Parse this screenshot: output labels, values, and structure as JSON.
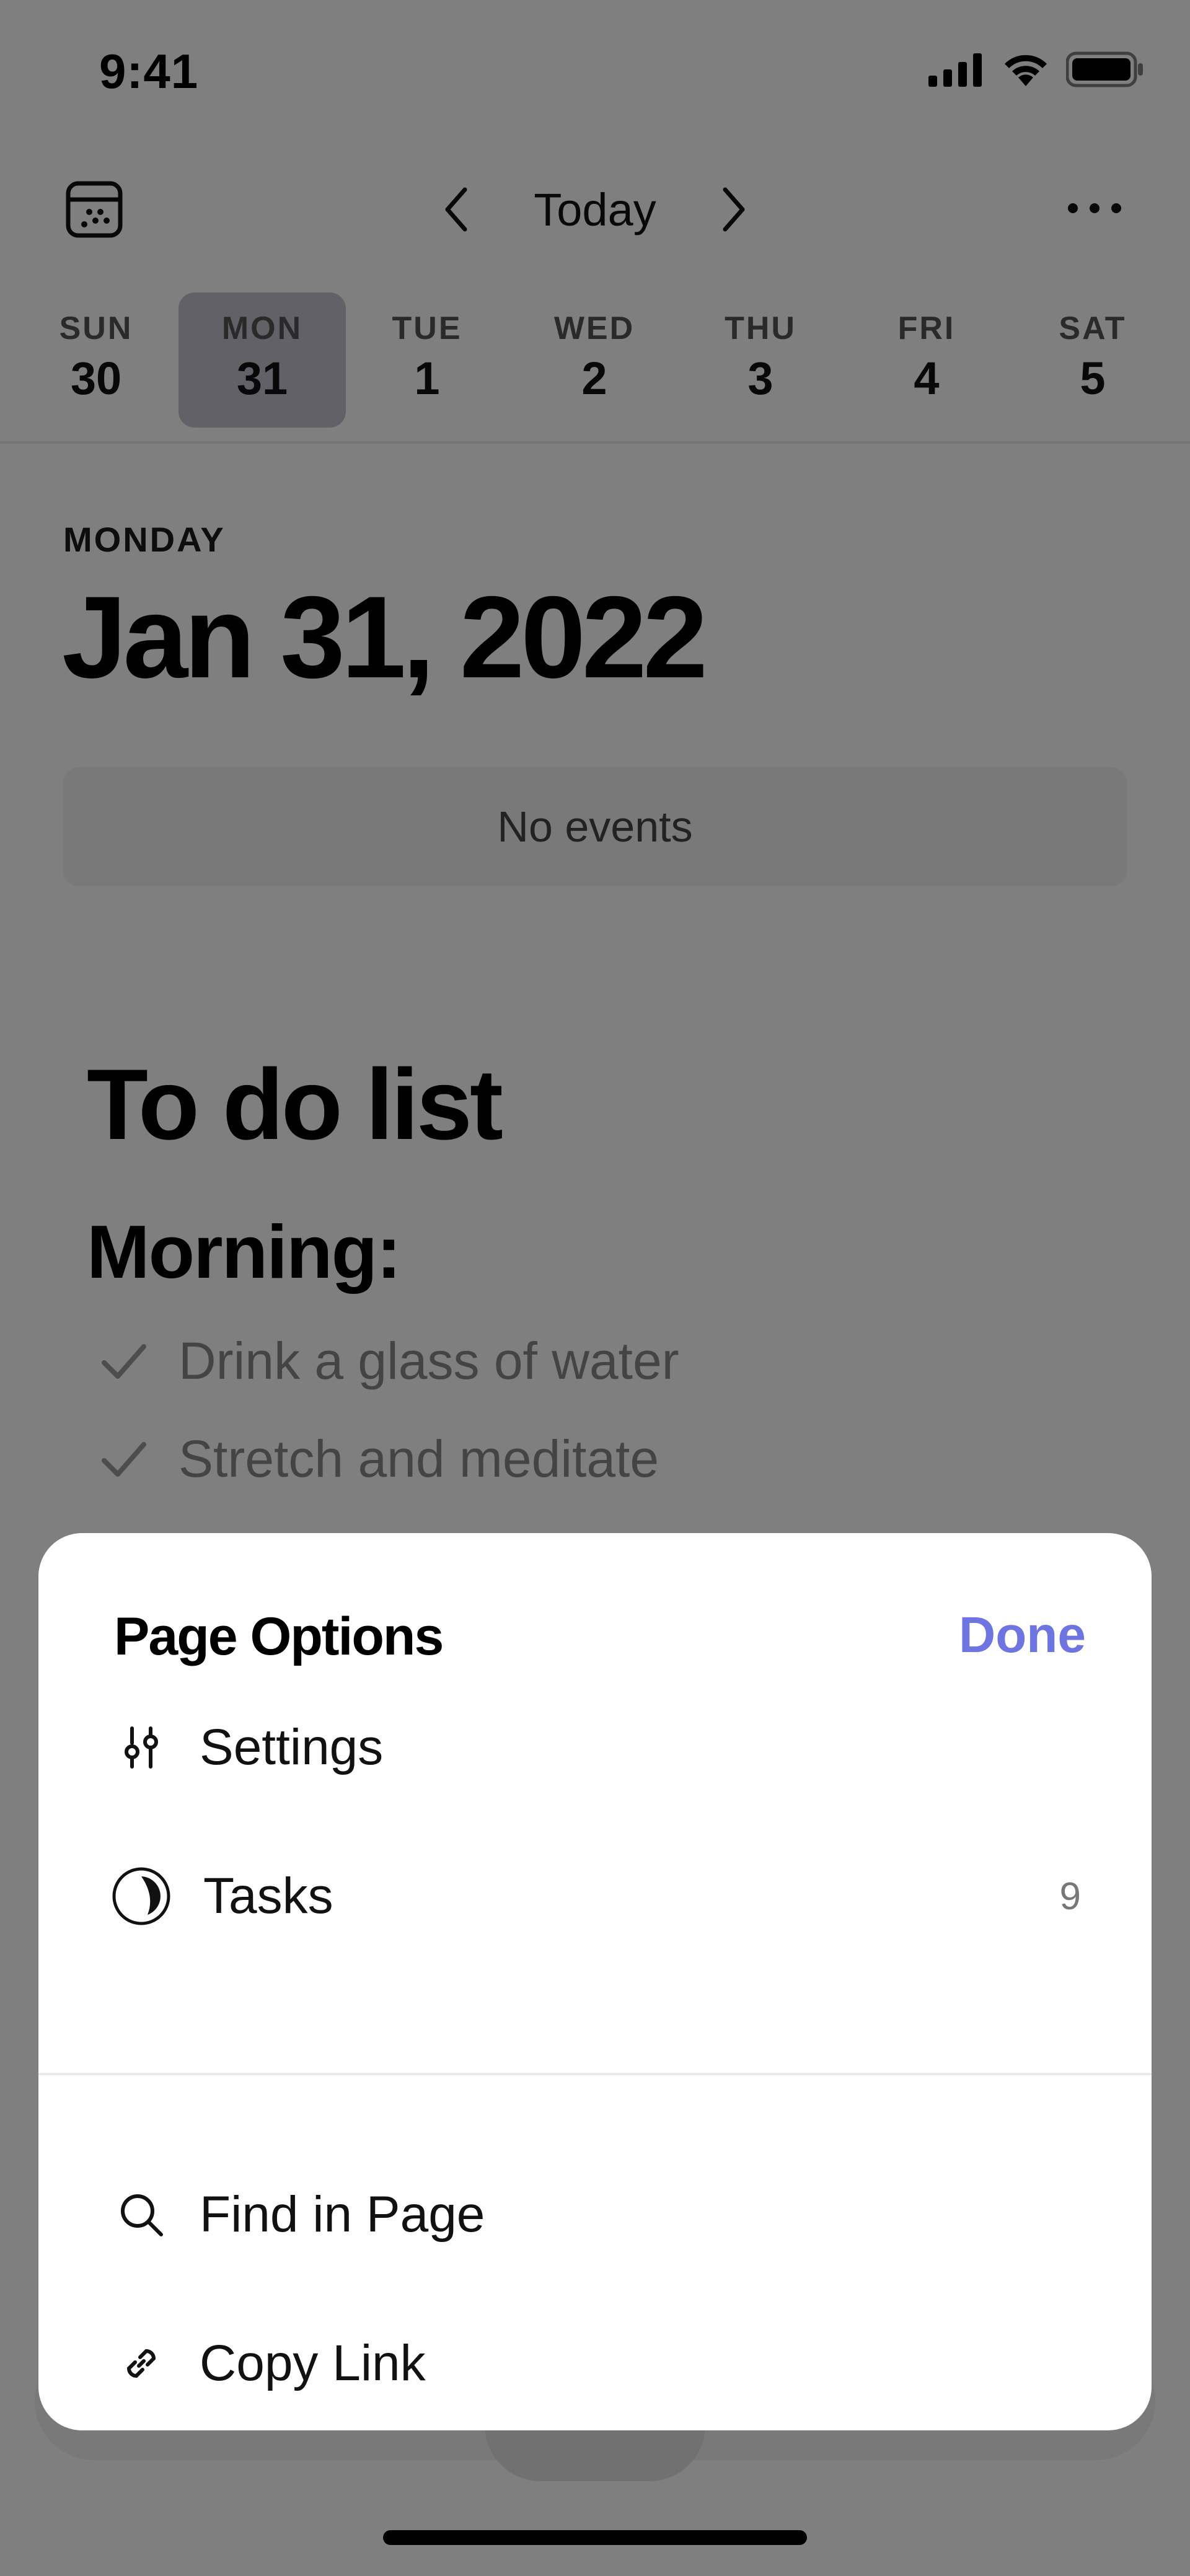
{
  "status_bar": {
    "time": "9:41",
    "icons": [
      "signal-icon",
      "wifi-icon",
      "battery-icon"
    ]
  },
  "nav": {
    "calendar_icon": "calendar-icon",
    "title": "Today",
    "prev_icon": "chevron-left-icon",
    "next_icon": "chevron-right-icon",
    "more_icon": "more-icon"
  },
  "week": {
    "days": [
      {
        "name": "SUN",
        "num": "30",
        "selected": false
      },
      {
        "name": "MON",
        "num": "31",
        "selected": true
      },
      {
        "name": "TUE",
        "num": "1",
        "selected": false
      },
      {
        "name": "WED",
        "num": "2",
        "selected": false
      },
      {
        "name": "THU",
        "num": "3",
        "selected": false
      },
      {
        "name": "FRI",
        "num": "4",
        "selected": false
      },
      {
        "name": "SAT",
        "num": "5",
        "selected": false
      }
    ],
    "selected_color": "#c2c3cf"
  },
  "day": {
    "weekday": "MONDAY",
    "date": "Jan 31, 2022",
    "events_text": "No events"
  },
  "page": {
    "title": "To do list",
    "section": "Morning:",
    "tasks": [
      {
        "text": "Drink a glass of water",
        "done": true
      },
      {
        "text": "Stretch and meditate",
        "done": true
      }
    ]
  },
  "sheet": {
    "title": "Page Options",
    "done_label": "Done",
    "accent_color": "#6e74e0",
    "items": [
      {
        "label": "Settings",
        "icon": "sliders-icon",
        "count": ""
      },
      {
        "label": "Tasks",
        "icon": "progress-circle-icon",
        "count": "9"
      },
      {
        "label": "Find in Page",
        "icon": "search-icon",
        "count": ""
      },
      {
        "label": "Copy Link",
        "icon": "link-icon",
        "count": ""
      }
    ]
  }
}
